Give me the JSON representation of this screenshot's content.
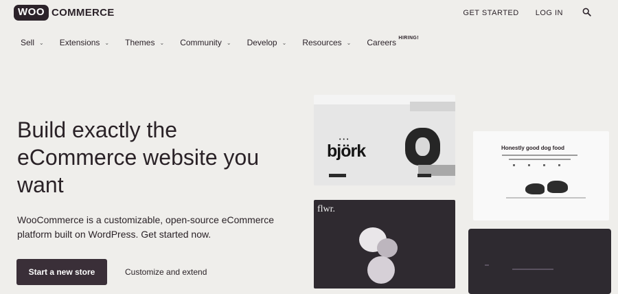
{
  "header": {
    "logo_badge": "WOO",
    "logo_word": "COMMERCE",
    "get_started": "GET STARTED",
    "log_in": "LOG IN",
    "search_icon": "search-icon"
  },
  "nav": {
    "items": [
      {
        "label": "Sell",
        "has_menu": true
      },
      {
        "label": "Extensions",
        "has_menu": true
      },
      {
        "label": "Themes",
        "has_menu": true
      },
      {
        "label": "Community",
        "has_menu": true
      },
      {
        "label": "Develop",
        "has_menu": true
      },
      {
        "label": "Resources",
        "has_menu": true
      },
      {
        "label": "Careers",
        "has_menu": false
      }
    ],
    "hiring_badge": "HIRING!"
  },
  "hero": {
    "title": "Build exactly the eCommerce website you want",
    "subtitle": "WooCommerce is a customizable, open-source eCommerce platform built on WordPress. Get started now.",
    "primary_cta": "Start a new store",
    "secondary_cta": "Customize and extend"
  },
  "showcase": {
    "bjork_word": "björk",
    "dog_title": "Honestly good dog food",
    "flwr_name": "flwr."
  },
  "colors": {
    "page_bg": "#efeeeb",
    "text": "#2a2227",
    "brand_dark": "#2b2229",
    "cta_bg": "#3a2f38",
    "card_dark": "#2e2a30"
  }
}
